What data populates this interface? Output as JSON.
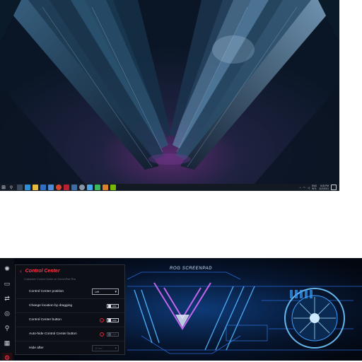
{
  "desktop": {
    "taskbar": {
      "tray": {
        "lang_top": "ENG",
        "lang_bottom": "INTL",
        "time": "5:03 PM",
        "date": "11/2/2021"
      }
    }
  },
  "screenpad": {
    "brand": "ROG SCREENPAD",
    "sidebar": {
      "items": [
        {
          "icon": "brightness-icon"
        },
        {
          "icon": "display-icon"
        },
        {
          "icon": "screen-swap-icon"
        },
        {
          "icon": "mouse-icon"
        },
        {
          "icon": "microphone-icon"
        },
        {
          "icon": "apps-grid-icon"
        },
        {
          "icon": "settings-icon",
          "active": true
        }
      ]
    },
    "control_center": {
      "title": "Control Center",
      "subtitle": "Customize Control Center on ScreenPad Plus",
      "rows": [
        {
          "label": "Control Center position",
          "control": "select",
          "value": "Left"
        },
        {
          "label": "Change location by dragging",
          "control": "toggle",
          "value": "OFF"
        },
        {
          "label": "Control Center button",
          "control": "toggle",
          "value": "OFF",
          "warning": true
        },
        {
          "label": "Auto-hide Control Center button",
          "control": "toggle",
          "value": "OFF",
          "warning": true,
          "disabled": true
        },
        {
          "label": "Hide after",
          "control": "select",
          "value": "10 sec",
          "disabled": true
        }
      ]
    },
    "colors": {
      "accent": "#ff3448"
    }
  }
}
